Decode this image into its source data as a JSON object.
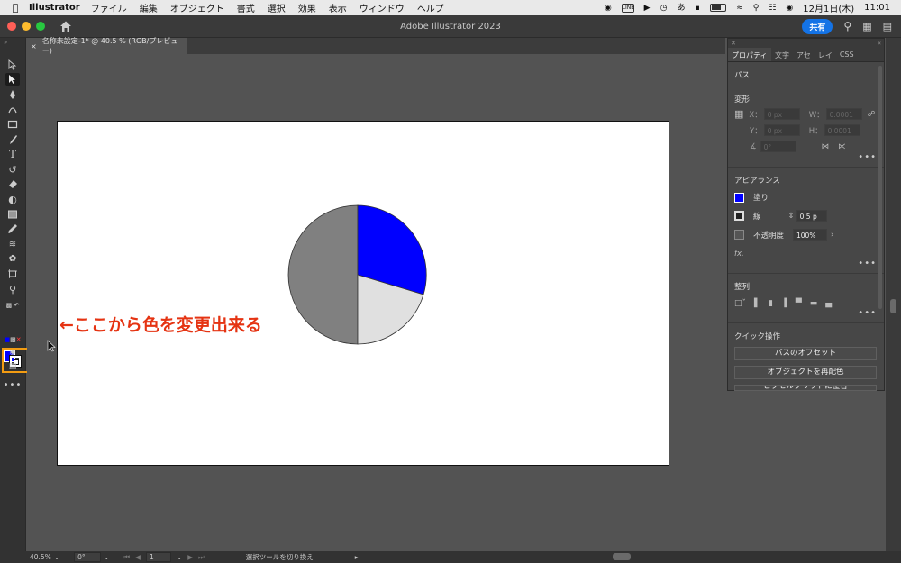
{
  "menubar": {
    "app_name": "Illustrator",
    "menus": [
      "ファイル",
      "編集",
      "オブジェクト",
      "書式",
      "選択",
      "効果",
      "表示",
      "ウィンドウ",
      "ヘルプ"
    ],
    "date": "12月1日(木)",
    "time": "11:01",
    "line_badge": "LINE",
    "input_method": "あ"
  },
  "titlebar": {
    "title": "Adobe Illustrator 2023",
    "share_label": "共有"
  },
  "document_tab": {
    "close": "×",
    "label": "名称未設定-1* @ 40.5 % (RGB/プレビュー)"
  },
  "canvas": {
    "annotation": "←ここから色を変更出来る",
    "pie_colors": {
      "gray": "#808080",
      "blue": "#0000ff",
      "light": "#e0e0e0"
    }
  },
  "colors": {
    "fill": "#0000ff",
    "highlight": "#f39c12",
    "annotation": "#e53312",
    "accent": "#1473e6"
  },
  "panel": {
    "tabs": [
      "プロパティ",
      "文字",
      "アセ",
      "レイ",
      "CSS"
    ],
    "object_type": "パス",
    "transform_title": "変形",
    "x_label": "X：",
    "x_value": "0 px",
    "y_label": "Y：",
    "y_value": "0 px",
    "w_label": "W：",
    "w_value": "0.0001",
    "h_label": "H：",
    "h_value": "0.0001",
    "angle_value": "0°",
    "appearance_title": "アピアランス",
    "fill_label": "塗り",
    "stroke_label": "線",
    "stroke_value": "0.5 p",
    "opacity_label": "不透明度",
    "opacity_value": "100%",
    "fx_label": "fx.",
    "align_title": "整列",
    "quick_title": "クイック操作",
    "quick_buttons": [
      "パスのオフセット",
      "オブジェクトを再配色",
      "ピクセルグリッドに整合"
    ],
    "more": "•••"
  },
  "statusbar": {
    "zoom": "40.5%",
    "rotation": "0°",
    "artboard": "1",
    "tool_status": "選択ツールを切り換え"
  }
}
